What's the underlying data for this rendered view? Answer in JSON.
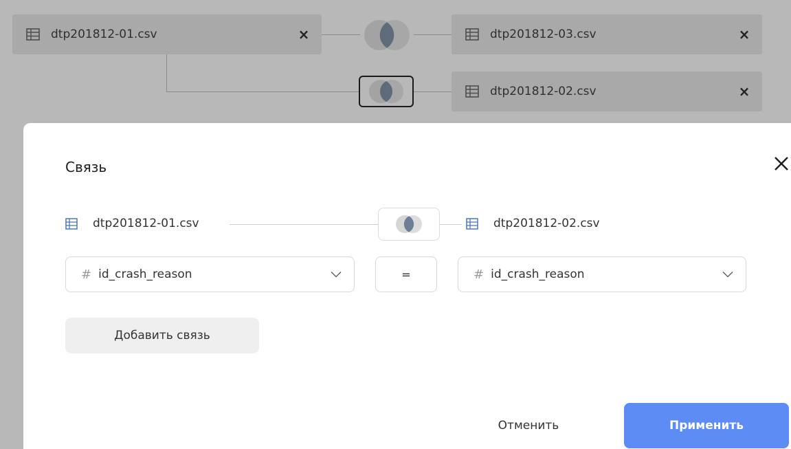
{
  "canvas": {
    "sources": [
      {
        "name": "dtp201812-01.csv",
        "remove": "×"
      },
      {
        "name": "dtp201812-03.csv",
        "remove": "×"
      },
      {
        "name": "dtp201812-02.csv",
        "remove": "×"
      }
    ]
  },
  "dialog": {
    "title": "Связь",
    "left_source": "dtp201812-01.csv",
    "right_source": "dtp201812-02.csv",
    "condition": {
      "left_field": "id_crash_reason",
      "operator": "=",
      "right_field": "id_crash_reason",
      "field_type_symbol": "#"
    },
    "add_link_label": "Добавить связь",
    "cancel_label": "Отменить",
    "apply_label": "Применить"
  },
  "colors": {
    "accent": "#5c8cf4",
    "overlay": "#b8b8b8",
    "venn": "#7a8a9c"
  }
}
